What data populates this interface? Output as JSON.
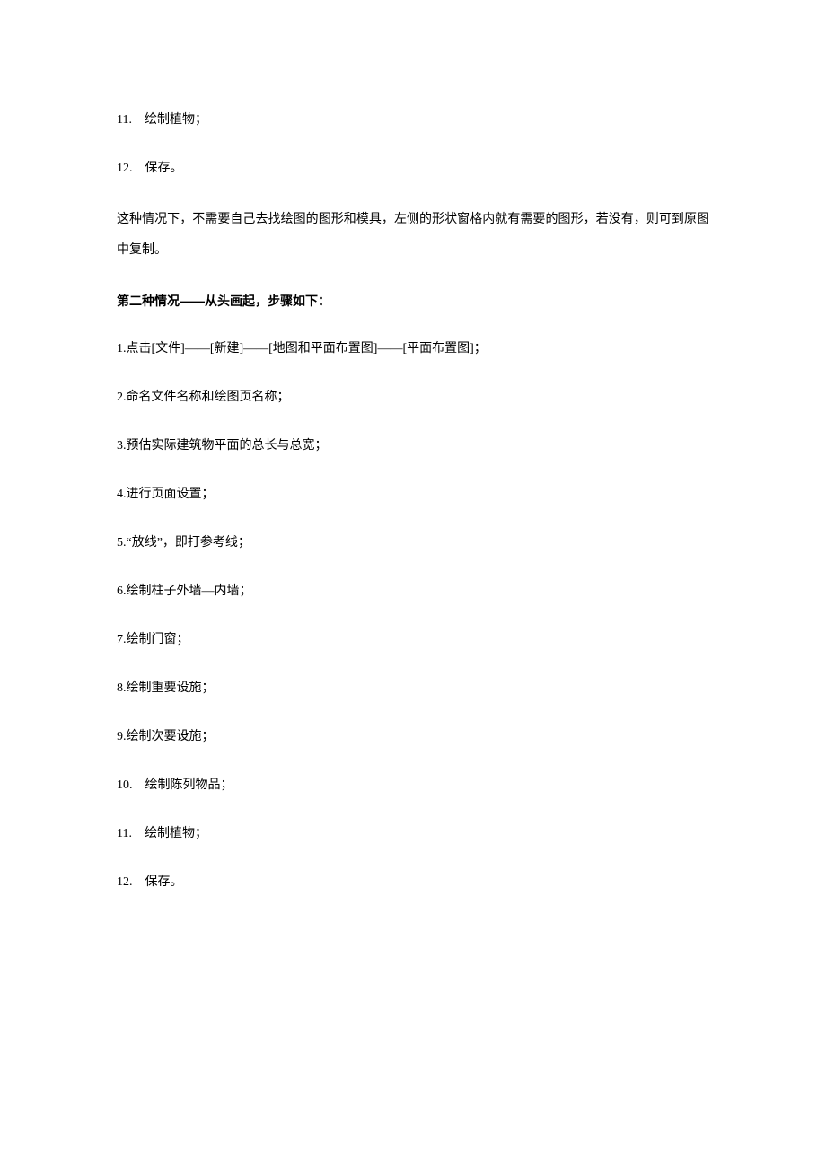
{
  "topList": [
    {
      "num": "11. ",
      "text": "绘制植物；"
    },
    {
      "num": "12. ",
      "text": "保存。"
    }
  ],
  "paragraph1": "这种情况下，不需要自己去找绘图的图形和模具，左侧的形状窗格内就有需要的图形，若没有，则可到原图中复制。",
  "heading": "第二种情况——从头画起，步骤如下：",
  "steps": [
    {
      "num": "1.",
      "text": "点击[文件]——[新建]——[地图和平面布置图]——[平面布置图]；"
    },
    {
      "num": "2.",
      "text": "命名文件名称和绘图页名称；"
    },
    {
      "num": "3.",
      "text": "预估实际建筑物平面的总长与总宽；"
    },
    {
      "num": "4.",
      "text": "进行页面设置；"
    },
    {
      "num": "5.",
      "text": "“放线”，即打参考线；"
    },
    {
      "num": "6.",
      "text": "绘制柱子外墙—内墙；"
    },
    {
      "num": "7.",
      "text": "绘制门窗；"
    },
    {
      "num": "8.",
      "text": "绘制重要设施；"
    },
    {
      "num": "9.",
      "text": "绘制次要设施；"
    },
    {
      "num": "10. ",
      "text": "绘制陈列物品；"
    },
    {
      "num": "11. ",
      "text": "绘制植物；"
    },
    {
      "num": "12. ",
      "text": "保存。"
    }
  ]
}
